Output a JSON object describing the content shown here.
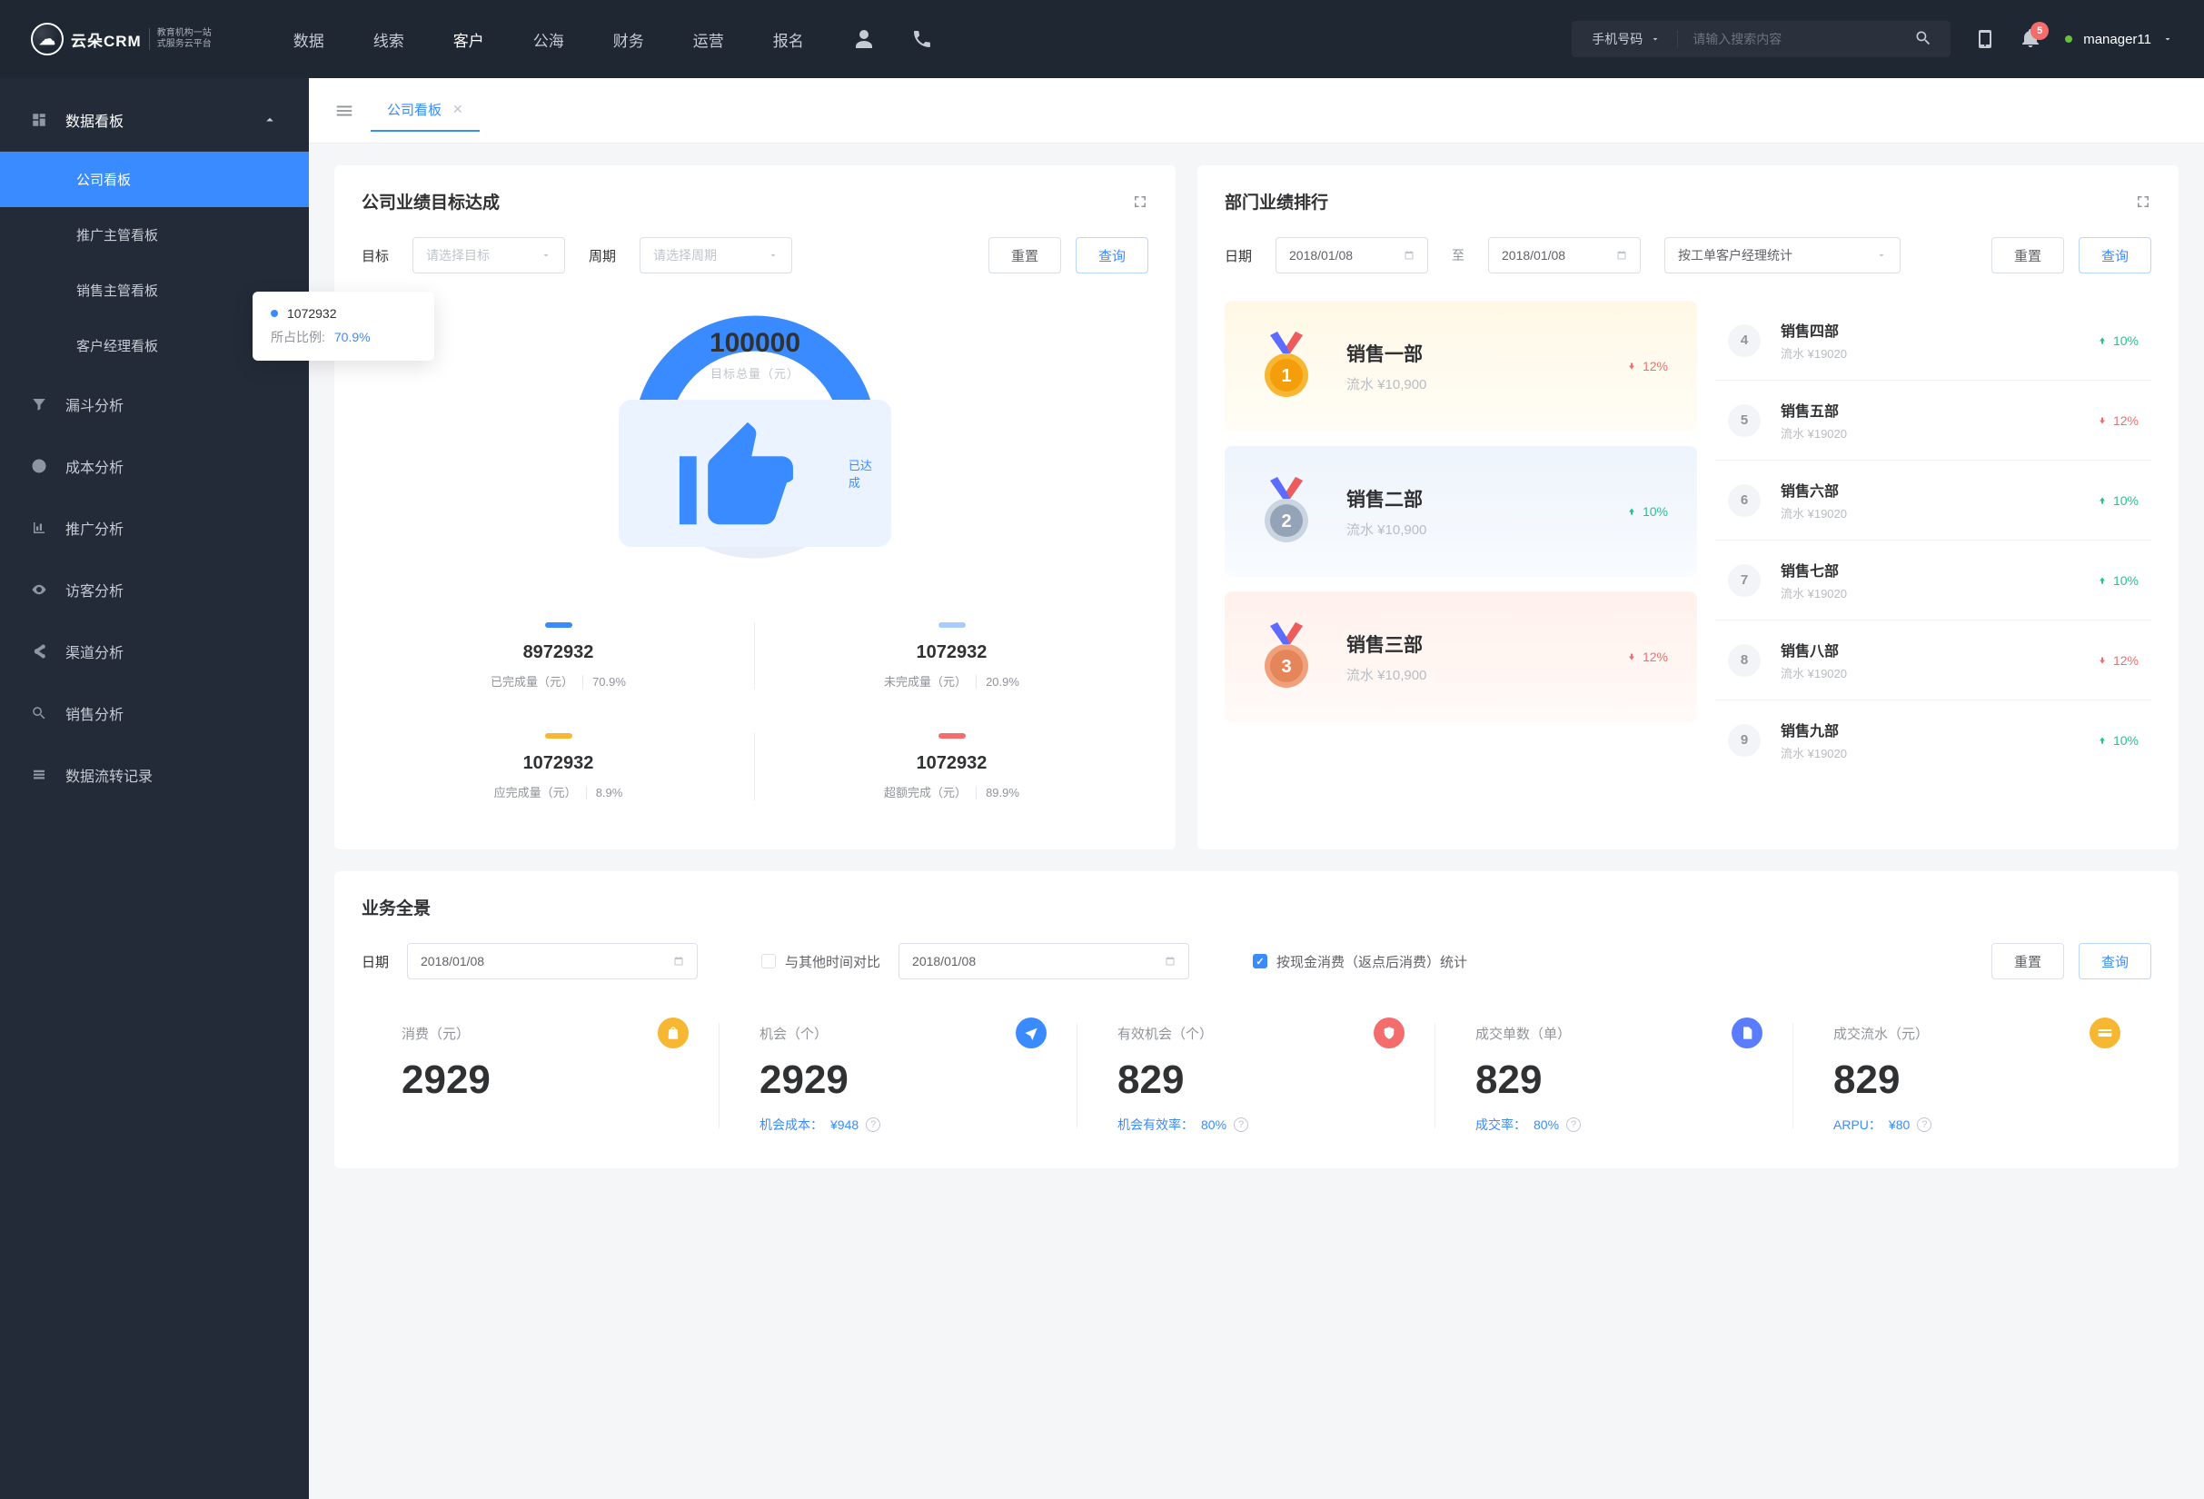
{
  "brand": {
    "name": "云朵CRM",
    "sub1": "教育机构一站",
    "sub2": "式服务云平台"
  },
  "nav": {
    "items": [
      "数据",
      "线索",
      "客户",
      "公海",
      "财务",
      "运营",
      "报名"
    ],
    "activeIndex": 2,
    "searchType": "手机号码",
    "searchPlaceholder": "请输入搜索内容",
    "notifCount": "5",
    "user": "manager11"
  },
  "sidebar": {
    "header": "数据看板",
    "subs": [
      "公司看板",
      "推广主管看板",
      "销售主管看板",
      "客户经理看板"
    ],
    "activeSub": 0,
    "items": [
      "漏斗分析",
      "成本分析",
      "推广分析",
      "访客分析",
      "渠道分析",
      "销售分析",
      "数据流转记录"
    ]
  },
  "tab": {
    "label": "公司看板"
  },
  "target": {
    "title": "公司业绩目标达成",
    "f": {
      "goalLabel": "目标",
      "goalPlaceholder": "请选择目标",
      "periodLabel": "周期",
      "periodPlaceholder": "请选择周期",
      "reset": "重置",
      "query": "查询"
    },
    "tooltip": {
      "value": "1072932",
      "ratioLabel": "所占比例:",
      "ratio": "70.9%"
    },
    "center": {
      "total": "100000",
      "label": "目标总量（元）",
      "badge": "已达成"
    },
    "stats": [
      {
        "color": "#3a8bff",
        "value": "8972932",
        "label": "已完成量（元）",
        "pct": "70.9%"
      },
      {
        "color": "#a9ccff",
        "value": "1072932",
        "label": "未完成量（元）",
        "pct": "20.9%"
      },
      {
        "color": "#f7b733",
        "value": "1072932",
        "label": "应完成量（元）",
        "pct": "8.9%"
      },
      {
        "color": "#f56c6c",
        "value": "1072932",
        "label": "超额完成（元）",
        "pct": "89.9%"
      }
    ]
  },
  "rank": {
    "title": "部门业绩排行",
    "f": {
      "dateLabel": "日期",
      "from": "2018/01/08",
      "to": "2018/01/08",
      "sep": "至",
      "group": "按工单客户经理统计",
      "reset": "重置",
      "query": "查询"
    },
    "podium": [
      {
        "name": "销售一部",
        "sub": "流水 ¥10,900",
        "trend": "down",
        "pct": "12%"
      },
      {
        "name": "销售二部",
        "sub": "流水 ¥10,900",
        "trend": "up",
        "pct": "10%"
      },
      {
        "name": "销售三部",
        "sub": "流水 ¥10,900",
        "trend": "down",
        "pct": "12%"
      }
    ],
    "rows": [
      {
        "n": "4",
        "name": "销售四部",
        "sub": "流水 ¥19020",
        "trend": "up",
        "pct": "10%"
      },
      {
        "n": "5",
        "name": "销售五部",
        "sub": "流水 ¥19020",
        "trend": "down",
        "pct": "12%"
      },
      {
        "n": "6",
        "name": "销售六部",
        "sub": "流水 ¥19020",
        "trend": "up",
        "pct": "10%"
      },
      {
        "n": "7",
        "name": "销售七部",
        "sub": "流水 ¥19020",
        "trend": "up",
        "pct": "10%"
      },
      {
        "n": "8",
        "name": "销售八部",
        "sub": "流水 ¥19020",
        "trend": "down",
        "pct": "12%"
      },
      {
        "n": "9",
        "name": "销售九部",
        "sub": "流水 ¥19020",
        "trend": "up",
        "pct": "10%"
      }
    ]
  },
  "overview": {
    "title": "业务全景",
    "f": {
      "dateLabel": "日期",
      "date1": "2018/01/08",
      "compare": "与其他时间对比",
      "date2": "2018/01/08",
      "checkbox": "按现金消费（返点后消费）统计",
      "reset": "重置",
      "query": "查询"
    },
    "metrics": [
      {
        "label": "消费（元）",
        "icon": "bag",
        "color": "#f7b733",
        "value": "2929",
        "subK": "",
        "subV": ""
      },
      {
        "label": "机会（个）",
        "icon": "plane",
        "color": "#3a8bff",
        "value": "2929",
        "subK": "机会成本：",
        "subV": "¥948"
      },
      {
        "label": "有效机会（个）",
        "icon": "shield",
        "color": "#f56c6c",
        "value": "829",
        "subK": "机会有效率：",
        "subV": "80%"
      },
      {
        "label": "成交单数（单）",
        "icon": "doc",
        "color": "#5a7dff",
        "value": "829",
        "subK": "成交率：",
        "subV": "80%"
      },
      {
        "label": "成交流水（元）",
        "icon": "card",
        "color": "#f7b733",
        "value": "829",
        "subK": "ARPU：",
        "subV": "¥80"
      }
    ]
  },
  "chart_data": {
    "type": "pie",
    "title": "目标总量（元） 100000",
    "series": [
      {
        "name": "已完成量（元）",
        "value": 8972932,
        "pct": 70.9,
        "color": "#3a8bff"
      },
      {
        "name": "未完成量（元）",
        "value": 1072932,
        "pct": 20.9,
        "color": "#a9ccff"
      },
      {
        "name": "应完成量（元）",
        "value": 1072932,
        "pct": 8.9,
        "color": "#f7b733"
      },
      {
        "name": "超额完成（元）",
        "value": 1072932,
        "pct": 89.9,
        "color": "#f56c6c"
      }
    ],
    "donut_segments": [
      {
        "name": "completed",
        "pct": 70.9,
        "color": "#3a8bff"
      },
      {
        "name": "remaining",
        "pct": 29.1,
        "color": "#e8eef8"
      }
    ]
  }
}
